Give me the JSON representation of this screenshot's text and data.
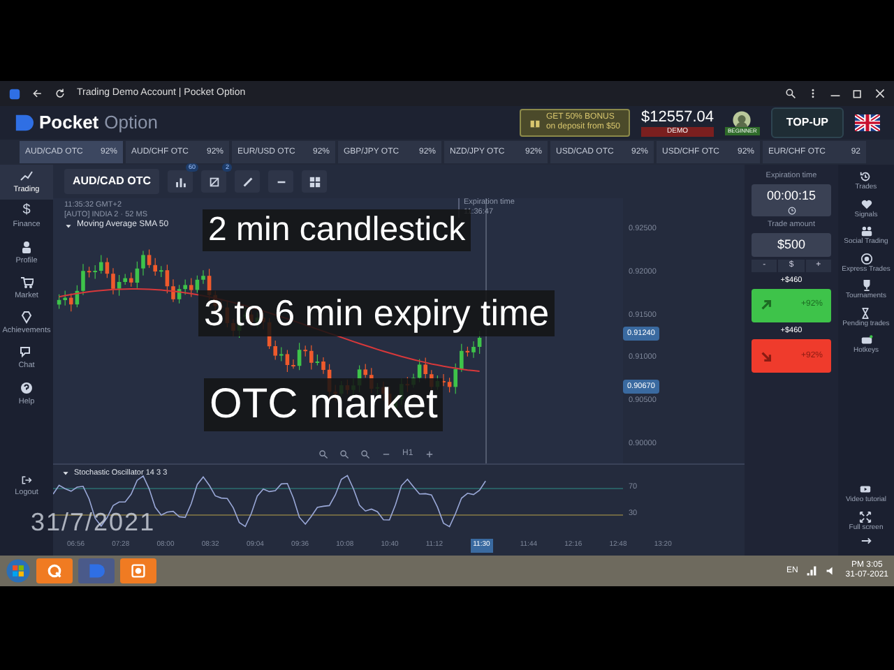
{
  "browser": {
    "title": "Trading Demo Account | Pocket Option"
  },
  "header": {
    "logo_bold": "Pocket",
    "logo_light": "Option",
    "bonus_title": "GET 50% BONUS",
    "bonus_sub": "on deposit from $50",
    "balance": "$12557.04",
    "account_mode": "DEMO",
    "level_badge": "BEGINNER",
    "topup": "TOP-UP"
  },
  "asset_tabs": [
    {
      "label": "AUD/CAD OTC",
      "payout": "92%",
      "selected": true
    },
    {
      "label": "AUD/CHF OTC",
      "payout": "92%",
      "selected": false
    },
    {
      "label": "EUR/USD OTC",
      "payout": "92%",
      "selected": false
    },
    {
      "label": "GBP/JPY OTC",
      "payout": "92%",
      "selected": false
    },
    {
      "label": "NZD/JPY OTC",
      "payout": "92%",
      "selected": false
    },
    {
      "label": "USD/CAD OTC",
      "payout": "92%",
      "selected": false
    },
    {
      "label": "USD/CHF OTC",
      "payout": "92%",
      "selected": false
    },
    {
      "label": "EUR/CHF OTC",
      "payout": "92",
      "selected": false
    }
  ],
  "left_nav": [
    {
      "label": "Trading",
      "selected": true
    },
    {
      "label": "Finance",
      "glyph": "$",
      "selected": false
    },
    {
      "label": "Profile",
      "selected": false
    },
    {
      "label": "Market",
      "selected": false
    },
    {
      "label": "Achievements",
      "selected": false
    },
    {
      "label": "Chat",
      "selected": false
    },
    {
      "label": "Help",
      "selected": false
    }
  ],
  "logout": "Logout",
  "chart": {
    "asset": "AUD/CAD OTC",
    "indicator_count": "60",
    "drawing_count": "2",
    "server_time": "11:35:32 GMT+2",
    "feed": "[AUTO] INDIA 2 · 52 MS",
    "indicator": "Moving Average SMA 50",
    "expiration_label": "Expiration time",
    "expiration_value": "11:36:47",
    "y_labels": [
      "0.92500",
      "0.92000",
      "0.91500",
      "0.91000",
      "0.90500",
      "0.90000"
    ],
    "price_tags": [
      "0.91240",
      "0.90670"
    ],
    "timeframe": "H1",
    "oscillator": "Stochastic Oscillator 14 3 3",
    "osc_levels": [
      "70",
      "30"
    ],
    "time_labels": [
      {
        "text": "06:56",
        "selected": false
      },
      {
        "text": "07:28",
        "selected": false
      },
      {
        "text": "08:00",
        "selected": false
      },
      {
        "text": "08:32",
        "selected": false
      },
      {
        "text": "09:04",
        "selected": false
      },
      {
        "text": "09:36",
        "selected": false
      },
      {
        "text": "10:08",
        "selected": false
      },
      {
        "text": "10:40",
        "selected": false
      },
      {
        "text": "11:12",
        "selected": false
      },
      {
        "text": "11:30",
        "selected": true
      },
      {
        "text": "11:44",
        "selected": false
      },
      {
        "text": "12:16",
        "selected": false
      },
      {
        "text": "12:48",
        "selected": false
      },
      {
        "text": "13:20",
        "selected": false
      }
    ]
  },
  "captions": [
    "2 min candlestick",
    "3 to 6 min expiry time",
    "OTC market"
  ],
  "date_stamp": "31/7/2021",
  "trade": {
    "expiration_label": "Expiration time",
    "expiration": "00:00:15",
    "amount_label": "Trade amount",
    "amount": "$500",
    "minus": "-",
    "currency": "$",
    "plus": "+",
    "up_profit": "+$460",
    "up_payout": "+92%",
    "down_profit": "+$460",
    "down_payout": "+92%"
  },
  "right_nav": [
    {
      "label": "Trades"
    },
    {
      "label": "Signals"
    },
    {
      "label": "Social Trading"
    },
    {
      "label": "Express Trades"
    },
    {
      "label": "Tournaments"
    },
    {
      "label": "Pending trades"
    },
    {
      "label": "Hotkeys"
    }
  ],
  "right_nav_bottom": [
    {
      "label": "Video tutorial"
    },
    {
      "label": "Full screen"
    }
  ],
  "taskbar": {
    "language": "EN",
    "time": "PM 3:05",
    "date": "31-07-2021"
  }
}
